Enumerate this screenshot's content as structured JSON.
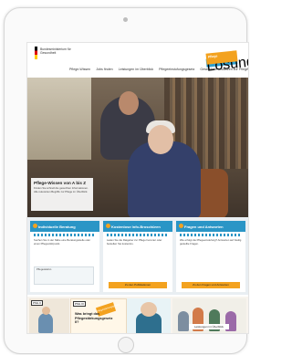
{
  "header": {
    "logo_text": "Bundesministerium für Gesundheit",
    "badge_top": "Pflege",
    "badge_bottom": "Lösungen"
  },
  "nav": [
    {
      "label": "Pflege-Wissen"
    },
    {
      "label": "Jobs finden"
    },
    {
      "label": "Leistungen im Überblick"
    },
    {
      "label": "Pflegeeinstufungsgesetz"
    },
    {
      "label": "Gesetzliche Instanzen zur Pflege"
    }
  ],
  "hero": {
    "title": "Pflege-Wissen von A bis Z",
    "text": "Finden Sie schnell die gesuchten Informationen. Alle relevanten Begriffe zur Pflege im Überblick."
  },
  "cards": [
    {
      "title": "Individuelle Beratung",
      "text": "Suchen Sie in der Nähe eine Beratungsstelle oder einen Pflegestützpunkt.",
      "sub": "Pflegetelefon",
      "button": ""
    },
    {
      "title": "Kostenlose Info-Broschüren",
      "text": "Laden Sie die Ratgeber zur Pflege herunter oder bestellen Sie kostenlos.",
      "sub": "",
      "button": "Zu den Publikationen"
    },
    {
      "title": "Fragen und Antworten",
      "text": "Wie erfolgt die Pflegeeinstufung? Antworten auf häufig gestellte Fragen.",
      "sub": "",
      "button": "Zu den Fragen und Antworten"
    }
  ],
  "comics": {
    "c1_tag": "PSG II",
    "c2_tag": "PSG III",
    "c2_note": "Pflegestärkungsgesetz",
    "c2_title": "Was bringt das Pflegestärkungsgesetz II?",
    "c4_caption": "Leistungen im Überblick"
  }
}
